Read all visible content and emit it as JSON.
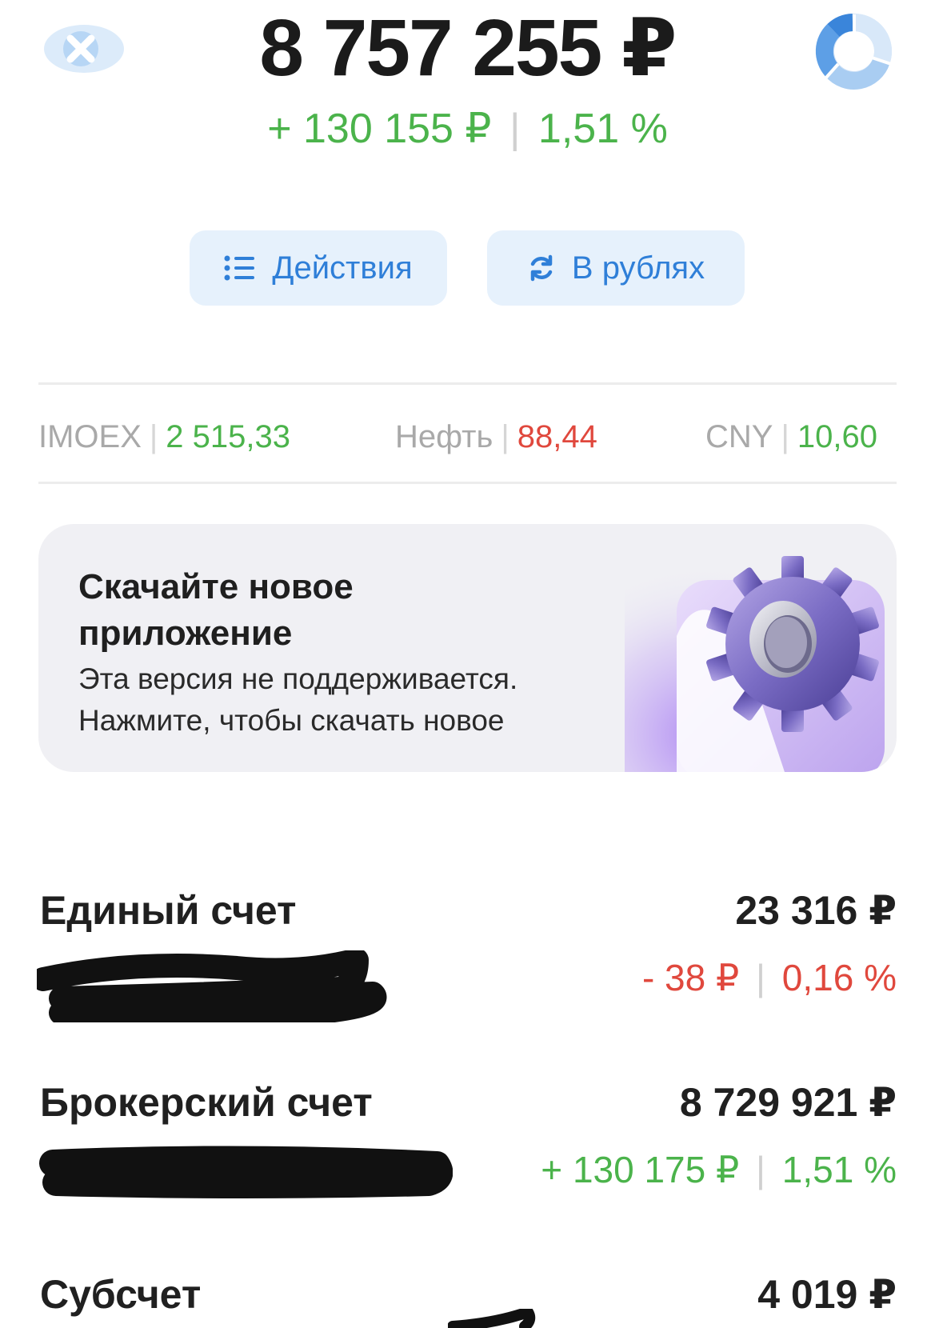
{
  "header": {
    "total_value": "8 757 255 ₽",
    "daily_change_amount": "+ 130 155 ₽",
    "daily_change_separator": "|",
    "daily_change_percent": "1,51 %"
  },
  "icons": {
    "hide_balance": "eye-slash-icon",
    "portfolio_chart": "donut-chart-icon",
    "actions": "list-icon",
    "currency": "refresh-icon"
  },
  "actions_bar": {
    "actions_label": "Действия",
    "currency_label": "В рублях"
  },
  "ticker": [
    {
      "label": "IMOEX",
      "separator": "|",
      "value": "2 515,33",
      "trend": "up"
    },
    {
      "label": "Нефть",
      "separator": "|",
      "value": "88,44",
      "trend": "down"
    },
    {
      "label": "CNY",
      "separator": "|",
      "value": "10,60",
      "trend": "up"
    }
  ],
  "banner": {
    "title": "Скачайте новое приложение",
    "text_line1": "Эта версия не поддерживается.",
    "text_line2": "Нажмите, чтобы скачать новое"
  },
  "accounts": [
    {
      "name": "Единый счет",
      "value": "23 316 ₽",
      "change_amount": "- 38 ₽",
      "change_separator": "|",
      "change_percent": "0,16 %",
      "trend": "down"
    },
    {
      "name": "Брокерский счет",
      "value": "8 729 921 ₽",
      "change_amount": "+ 130 175 ₽",
      "change_separator": "|",
      "change_percent": "1,51 %",
      "trend": "up"
    },
    {
      "name": "Субсчет",
      "value": "4 019 ₽"
    }
  ],
  "colors": {
    "positive": "#4bb34b",
    "negative": "#e0483d",
    "accent": "#2f7fd8",
    "button_bg": "#e6f1fc",
    "banner_bg": "#f0f0f4"
  }
}
